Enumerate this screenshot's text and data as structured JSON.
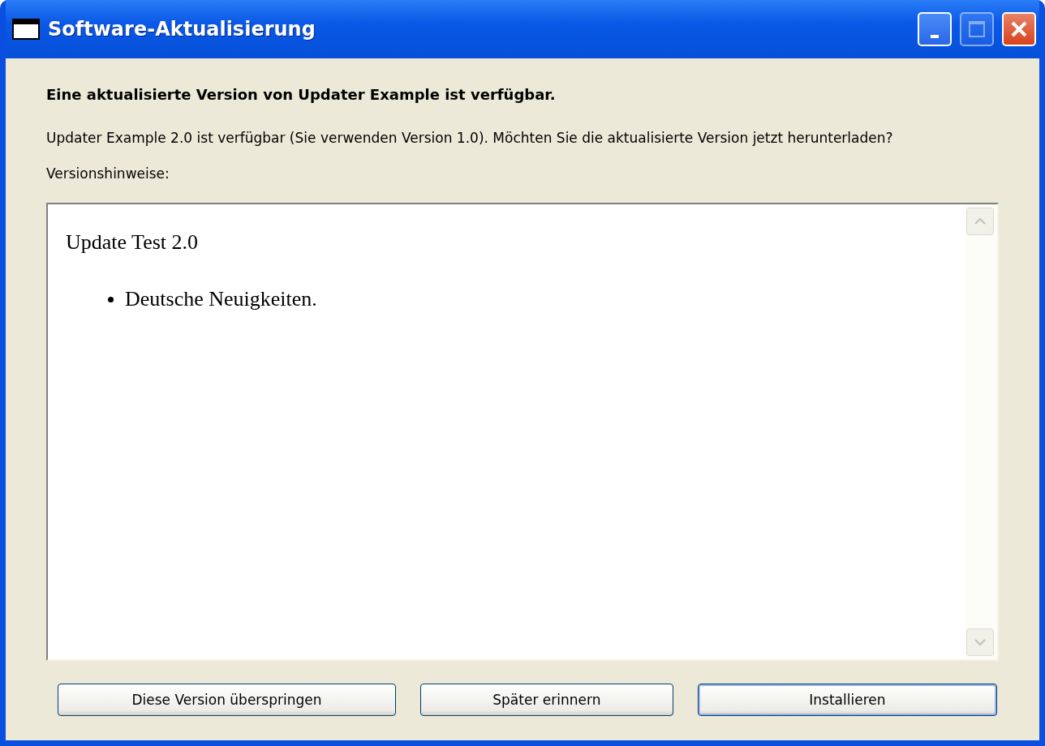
{
  "window": {
    "title": "Software-Aktualisierung",
    "controls": [
      {
        "kind": "minimize",
        "disabled": false
      },
      {
        "kind": "maximize",
        "disabled": true
      },
      {
        "kind": "close",
        "disabled": false
      }
    ]
  },
  "heading": "Eine aktualisierte Version von Updater Example ist verfügbar.",
  "description": "Updater Example 2.0 ist verfügbar (Sie verwenden Version 1.0). Möchten Sie die aktualisierte Version jetzt herunterladen?",
  "notes_label": "Versionshinweise:",
  "notes": {
    "title": "Update Test 2.0",
    "items": [
      "Deutsche Neuigkeiten."
    ]
  },
  "buttons": [
    {
      "label": "Diese Version überspringen",
      "default": false
    },
    {
      "label": "Später erinnern",
      "default": false
    },
    {
      "label": "Installieren",
      "default": true
    }
  ]
}
